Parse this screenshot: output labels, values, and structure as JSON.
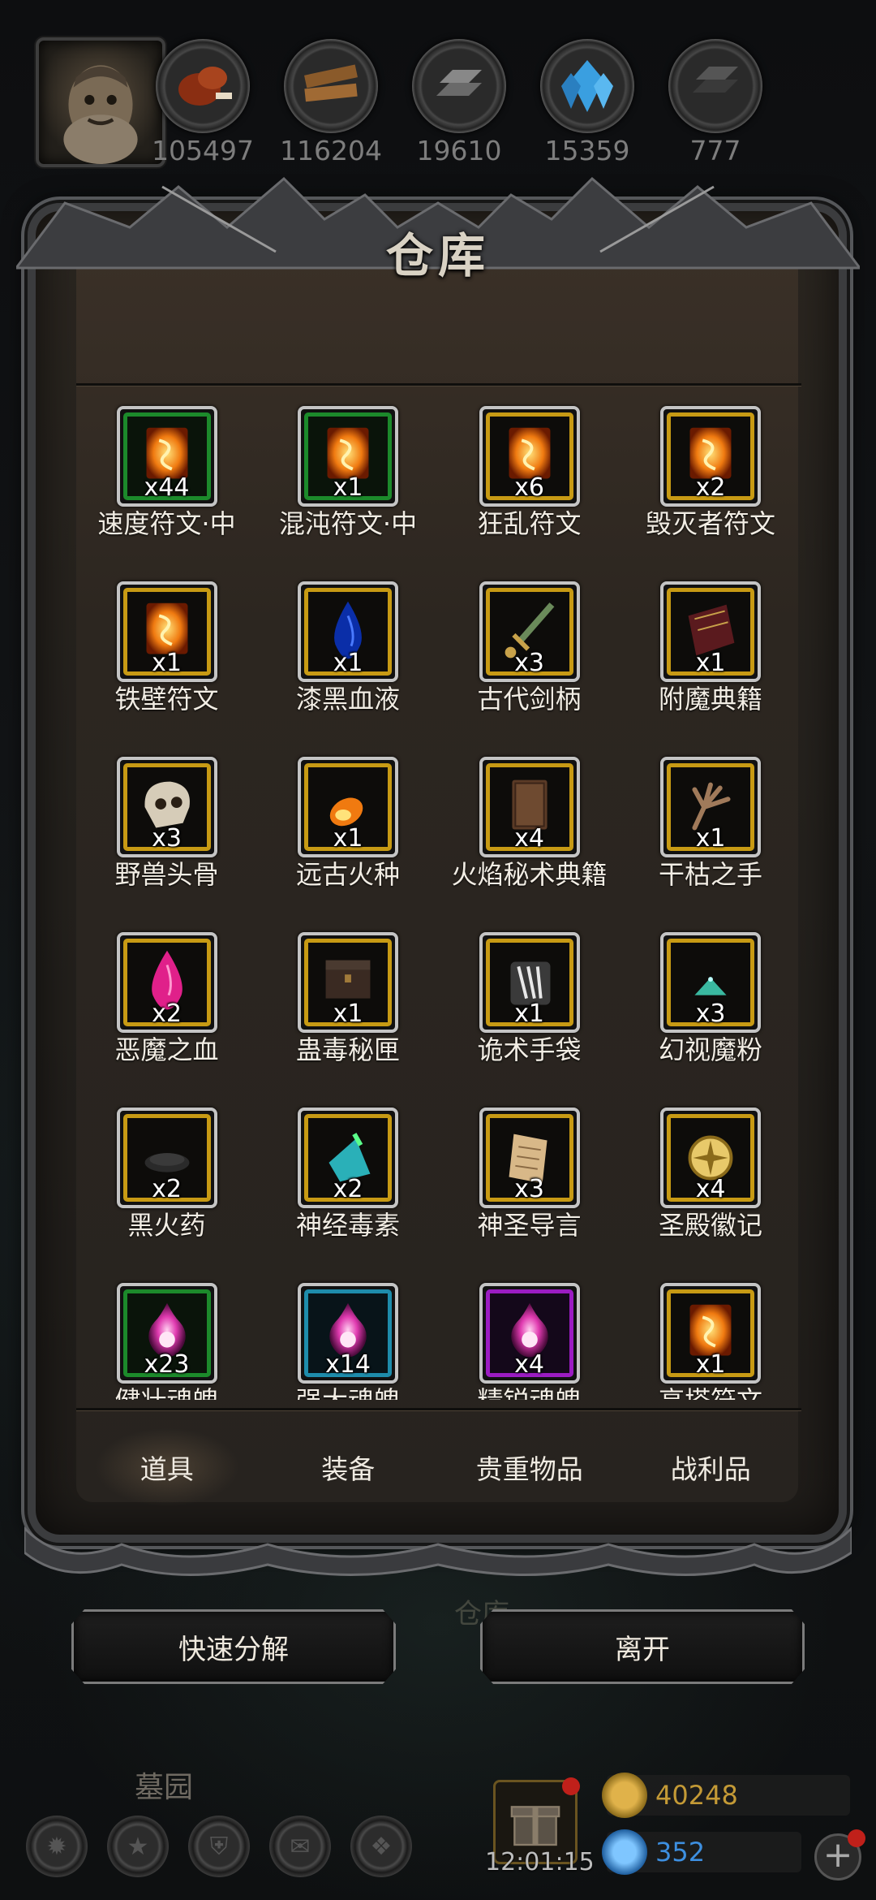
{
  "resources": [
    {
      "icon": "meat-icon",
      "value": "105497"
    },
    {
      "icon": "wood-planks-icon",
      "value": "116204"
    },
    {
      "icon": "iron-ingots-icon",
      "value": "19610"
    },
    {
      "icon": "blue-crystal-icon",
      "value": "15359"
    },
    {
      "icon": "dark-metal-icon",
      "value": "777"
    }
  ],
  "panel": {
    "title": "仓库",
    "items": [
      {
        "name": "速度符文·中",
        "qty": "x44",
        "rarity": "green",
        "icon": "rune-icon"
      },
      {
        "name": "混沌符文·中",
        "qty": "x1",
        "rarity": "green",
        "icon": "rune-icon"
      },
      {
        "name": "狂乱符文",
        "qty": "x6",
        "rarity": "gold",
        "icon": "rune-icon"
      },
      {
        "name": "毁灭者符文",
        "qty": "x2",
        "rarity": "gold",
        "icon": "rune-icon"
      },
      {
        "name": "铁壁符文",
        "qty": "x1",
        "rarity": "gold",
        "icon": "rune-icon"
      },
      {
        "name": "漆黑血液",
        "qty": "x1",
        "rarity": "gold",
        "icon": "dark-blood-icon"
      },
      {
        "name": "古代剑柄",
        "qty": "x3",
        "rarity": "gold",
        "icon": "sword-hilt-icon"
      },
      {
        "name": "附魔典籍",
        "qty": "x1",
        "rarity": "gold",
        "icon": "tome-icon"
      },
      {
        "name": "野兽头骨",
        "qty": "x3",
        "rarity": "gold",
        "icon": "skull-icon"
      },
      {
        "name": "远古火种",
        "qty": "x1",
        "rarity": "gold",
        "icon": "fire-ember-icon"
      },
      {
        "name": "火焰秘术典籍",
        "qty": "x4",
        "rarity": "gold",
        "icon": "book-icon"
      },
      {
        "name": "干枯之手",
        "qty": "x1",
        "rarity": "gold",
        "icon": "withered-hand-icon"
      },
      {
        "name": "恶魔之血",
        "qty": "x2",
        "rarity": "gold",
        "icon": "demon-blood-icon"
      },
      {
        "name": "蛊毒秘匣",
        "qty": "x1",
        "rarity": "gold",
        "icon": "chest-icon"
      },
      {
        "name": "诡术手袋",
        "qty": "x1",
        "rarity": "gold",
        "icon": "pouch-icon"
      },
      {
        "name": "幻视魔粉",
        "qty": "x3",
        "rarity": "gold",
        "icon": "powder-icon"
      },
      {
        "name": "黑火药",
        "qty": "x2",
        "rarity": "gold",
        "icon": "gunpowder-icon"
      },
      {
        "name": "神经毒素",
        "qty": "x2",
        "rarity": "gold",
        "icon": "toxin-icon"
      },
      {
        "name": "神圣导言",
        "qty": "x3",
        "rarity": "gold",
        "icon": "scroll-icon"
      },
      {
        "name": "圣殿徽记",
        "qty": "x4",
        "rarity": "gold",
        "icon": "emblem-icon"
      },
      {
        "name": "健壮魂魄",
        "qty": "x23",
        "rarity": "green",
        "icon": "soul-orb-icon"
      },
      {
        "name": "强大魂魄",
        "qty": "x14",
        "rarity": "blue",
        "icon": "soul-orb-icon"
      },
      {
        "name": "精锐魂魄",
        "qty": "x4",
        "rarity": "purple",
        "icon": "soul-orb-icon"
      },
      {
        "name": "高塔符文",
        "qty": "x1",
        "rarity": "gold",
        "icon": "rune-icon"
      }
    ],
    "tabs": [
      "道具",
      "装备",
      "贵重物品",
      "战利品"
    ],
    "active_tab": 0
  },
  "buttons": {
    "quick_decompose": "快速分解",
    "leave": "离开"
  },
  "background_label": "仓库",
  "hud": {
    "location": "墓园",
    "clock": "12:01:15",
    "gold": "40248",
    "gems": "352"
  },
  "colors": {
    "gold_frame": "#c79a14",
    "green_frame": "#1c8a2b",
    "blue_frame": "#1e8cab",
    "purple_frame": "#9b1cc2"
  }
}
